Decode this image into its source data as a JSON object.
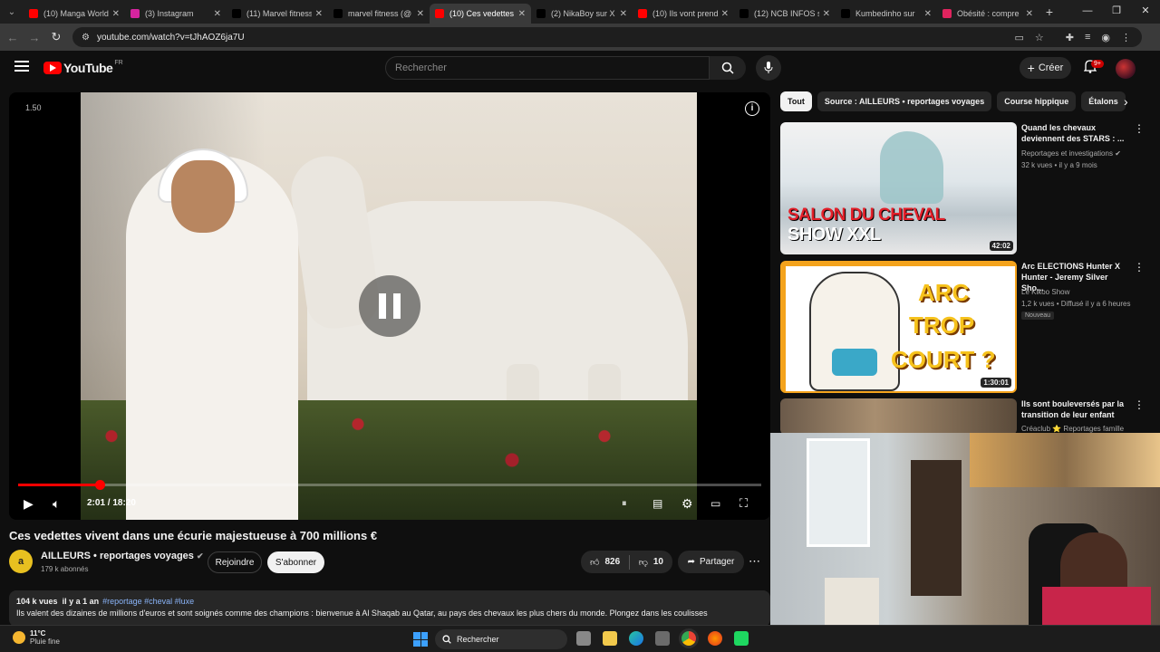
{
  "browser": {
    "tabs": [
      {
        "label": "(10) Manga World",
        "icon": "youtube-icon",
        "color": "#ff0000"
      },
      {
        "label": "(3) Instagram",
        "icon": "instagram-icon",
        "color": "#d6249f"
      },
      {
        "label": "(11) Marvel fitness",
        "icon": "x-icon",
        "color": "#000000"
      },
      {
        "label": "marvel fitness (@",
        "icon": "tiktok-icon",
        "color": "#000000"
      },
      {
        "label": "(10) Ces vedettes",
        "icon": "youtube-icon",
        "color": "#ff0000",
        "active": true
      },
      {
        "label": "(2) NikaBoy sur X",
        "icon": "x-icon",
        "color": "#000000"
      },
      {
        "label": "(10) Ils vont prend",
        "icon": "youtube-icon",
        "color": "#ff0000"
      },
      {
        "label": "(12) NCB INFOS s",
        "icon": "x-icon",
        "color": "#000000"
      },
      {
        "label": "Kumbedinho sur",
        "icon": "x-icon",
        "color": "#000000"
      },
      {
        "label": "Obésité : compre",
        "icon": "web-icon",
        "color": "#e0245e"
      }
    ],
    "url": "youtube.com/watch?v=tJhAOZ6ja7U"
  },
  "header": {
    "logo_text": "YouTube",
    "region": "FR",
    "search_placeholder": "Rechercher",
    "create_label": "Créer",
    "notif_count": "9+"
  },
  "player": {
    "speed_label": "1.50",
    "time": "2:01 / 18:20",
    "progress_fraction": 0.11
  },
  "video": {
    "title": "Ces vedettes vivent dans une écurie majestueuse à 700 millions €",
    "channel": "AILLEURS • reportages voyages",
    "channel_initial": "a",
    "subscribers": "179 k abonnés",
    "join_label": "Rejoindre",
    "subscribe_label": "S'abonner",
    "likes": "826",
    "dislikes": "10",
    "share_label": "Partager",
    "views": "104 k vues",
    "age": "il y a 1 an",
    "tags": "#reportage #cheval #luxe",
    "description": "Ils valent des dizaines de millions d'euros et sont soignés comme des champions : bienvenue à Al Shaqab au Qatar, au pays des chevaux les plus chers du monde. Plongez dans les coulisses"
  },
  "chips": [
    "Tout",
    "Source : AILLEURS • reportages voyages",
    "Course hippique",
    "Étalons"
  ],
  "recommendations": [
    {
      "title": "Quand les chevaux deviennent des STARS : ...",
      "channel": "Reportages et investigations",
      "meta": "32 k vues • il y a 9 mois",
      "duration": "42:02",
      "thumb_line1": "SALON DU CHEVAL",
      "thumb_line2": "SHOW XXL",
      "new": ""
    },
    {
      "title": "Arc ELECTIONS Hunter X Hunter - Jeremy Silver Sho...",
      "channel": "Le Kikoo Show",
      "meta": "1,2 k vues • Diffusé il y a 6 heures",
      "duration": "1:30:01",
      "thumb_line1": "ARC",
      "thumb_line2": "TROP",
      "thumb_line3": "COURT ?",
      "new": "Nouveau"
    },
    {
      "title": "Ils sont bouleversés par la transition de leur enfant",
      "channel": "Créaclub ⭐ Reportages famille",
      "meta": "",
      "duration": "",
      "new": ""
    }
  ],
  "taskbar": {
    "temp": "11°C",
    "weather": "Pluie fine",
    "search_label": "Rechercher"
  }
}
